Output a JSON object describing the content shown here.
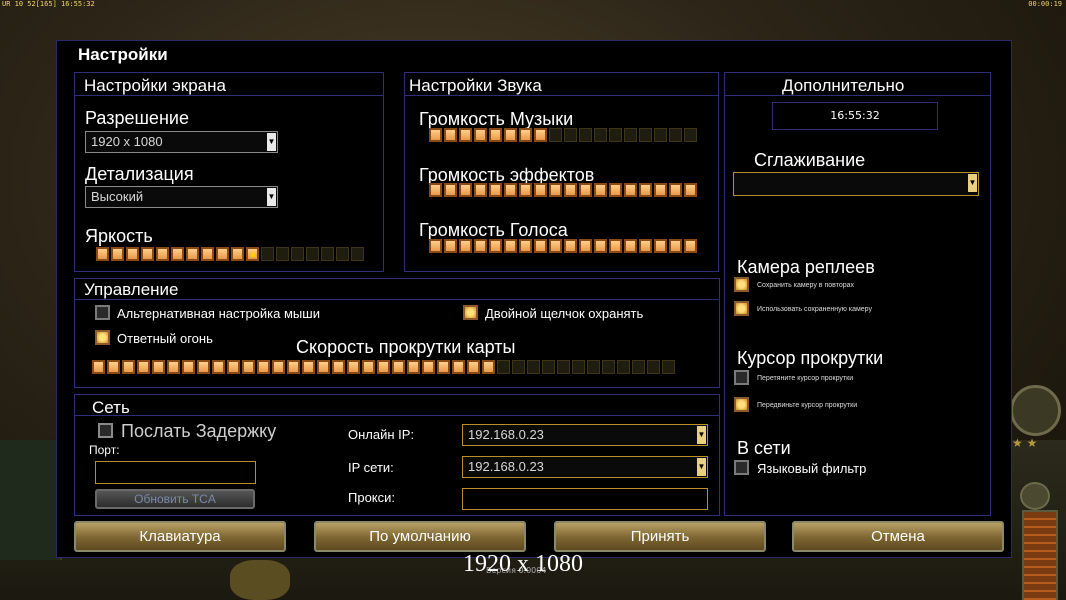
{
  "topbar": {
    "left": "UR 10 52[165] 16:55:32",
    "right": "00:00:19"
  },
  "title": "Настройки",
  "screen": {
    "header": "Настройки экрана",
    "resolution_label": "Разрешение",
    "resolution_value": "1920 x 1080",
    "detail_label": "Детализация",
    "detail_value": "Высокий",
    "brightness_label": "Яркость",
    "brightness_fraction": 0.62
  },
  "sound": {
    "header": "Настройки Звука",
    "music_label": "Громкость Музыки",
    "music_fraction": 0.45,
    "effects_label": "Громкость эффектов",
    "effects_fraction": 1.0,
    "voice_label": "Громкость Голоса",
    "voice_fraction": 1.0
  },
  "controls": {
    "header": "Управление",
    "alt_mouse_label": "Альтернативная настройка мыши",
    "alt_mouse_checked": false,
    "double_click_label": "Двойной щелчок охранять",
    "double_click_checked": true,
    "retaliation_label": "Ответный огонь",
    "retaliation_checked": true,
    "scroll_speed_label": "Скорость прокрутки карты",
    "scroll_speed_fraction": 0.68
  },
  "network": {
    "header": "Сеть",
    "send_delay_label": "Послать Задержку",
    "port_label": "Порт:",
    "update_button": "Обновить TCA",
    "online_ip_label": "Онлайн IP:",
    "online_ip_value": "192.168.0.23",
    "lan_ip_label": "IP сети:",
    "lan_ip_value": "192.168.0.23",
    "proxy_label": "Прокси:"
  },
  "additional": {
    "header": "Дополнительно",
    "clock": "16:55:32",
    "antialias_label": "Сглаживание",
    "replay_camera_header": "Камера реплеев",
    "save_camera_label": "Сохранить камеру в повторах",
    "save_camera_checked": true,
    "use_saved_camera_label": "Использовать сохраненную камеру",
    "use_saved_camera_checked": true,
    "scroll_cursor_header": "Курсор прокрутки",
    "drag_cursor_label": "Перетяните курсор прокрутки",
    "drag_cursor_checked": false,
    "move_cursor_label": "Передвиньте курсор прокрутки",
    "move_cursor_checked": true,
    "online_header": "В сети",
    "language_filter_label": "Языковый фильтр",
    "language_filter_checked": false
  },
  "buttons": {
    "keyboard": "Клавиатура",
    "defaults": "По умолчанию",
    "accept": "Принять",
    "cancel": "Отмена"
  },
  "overlay_resolution": "1920 x 1080",
  "overlay_version": "Версия 0.0004"
}
